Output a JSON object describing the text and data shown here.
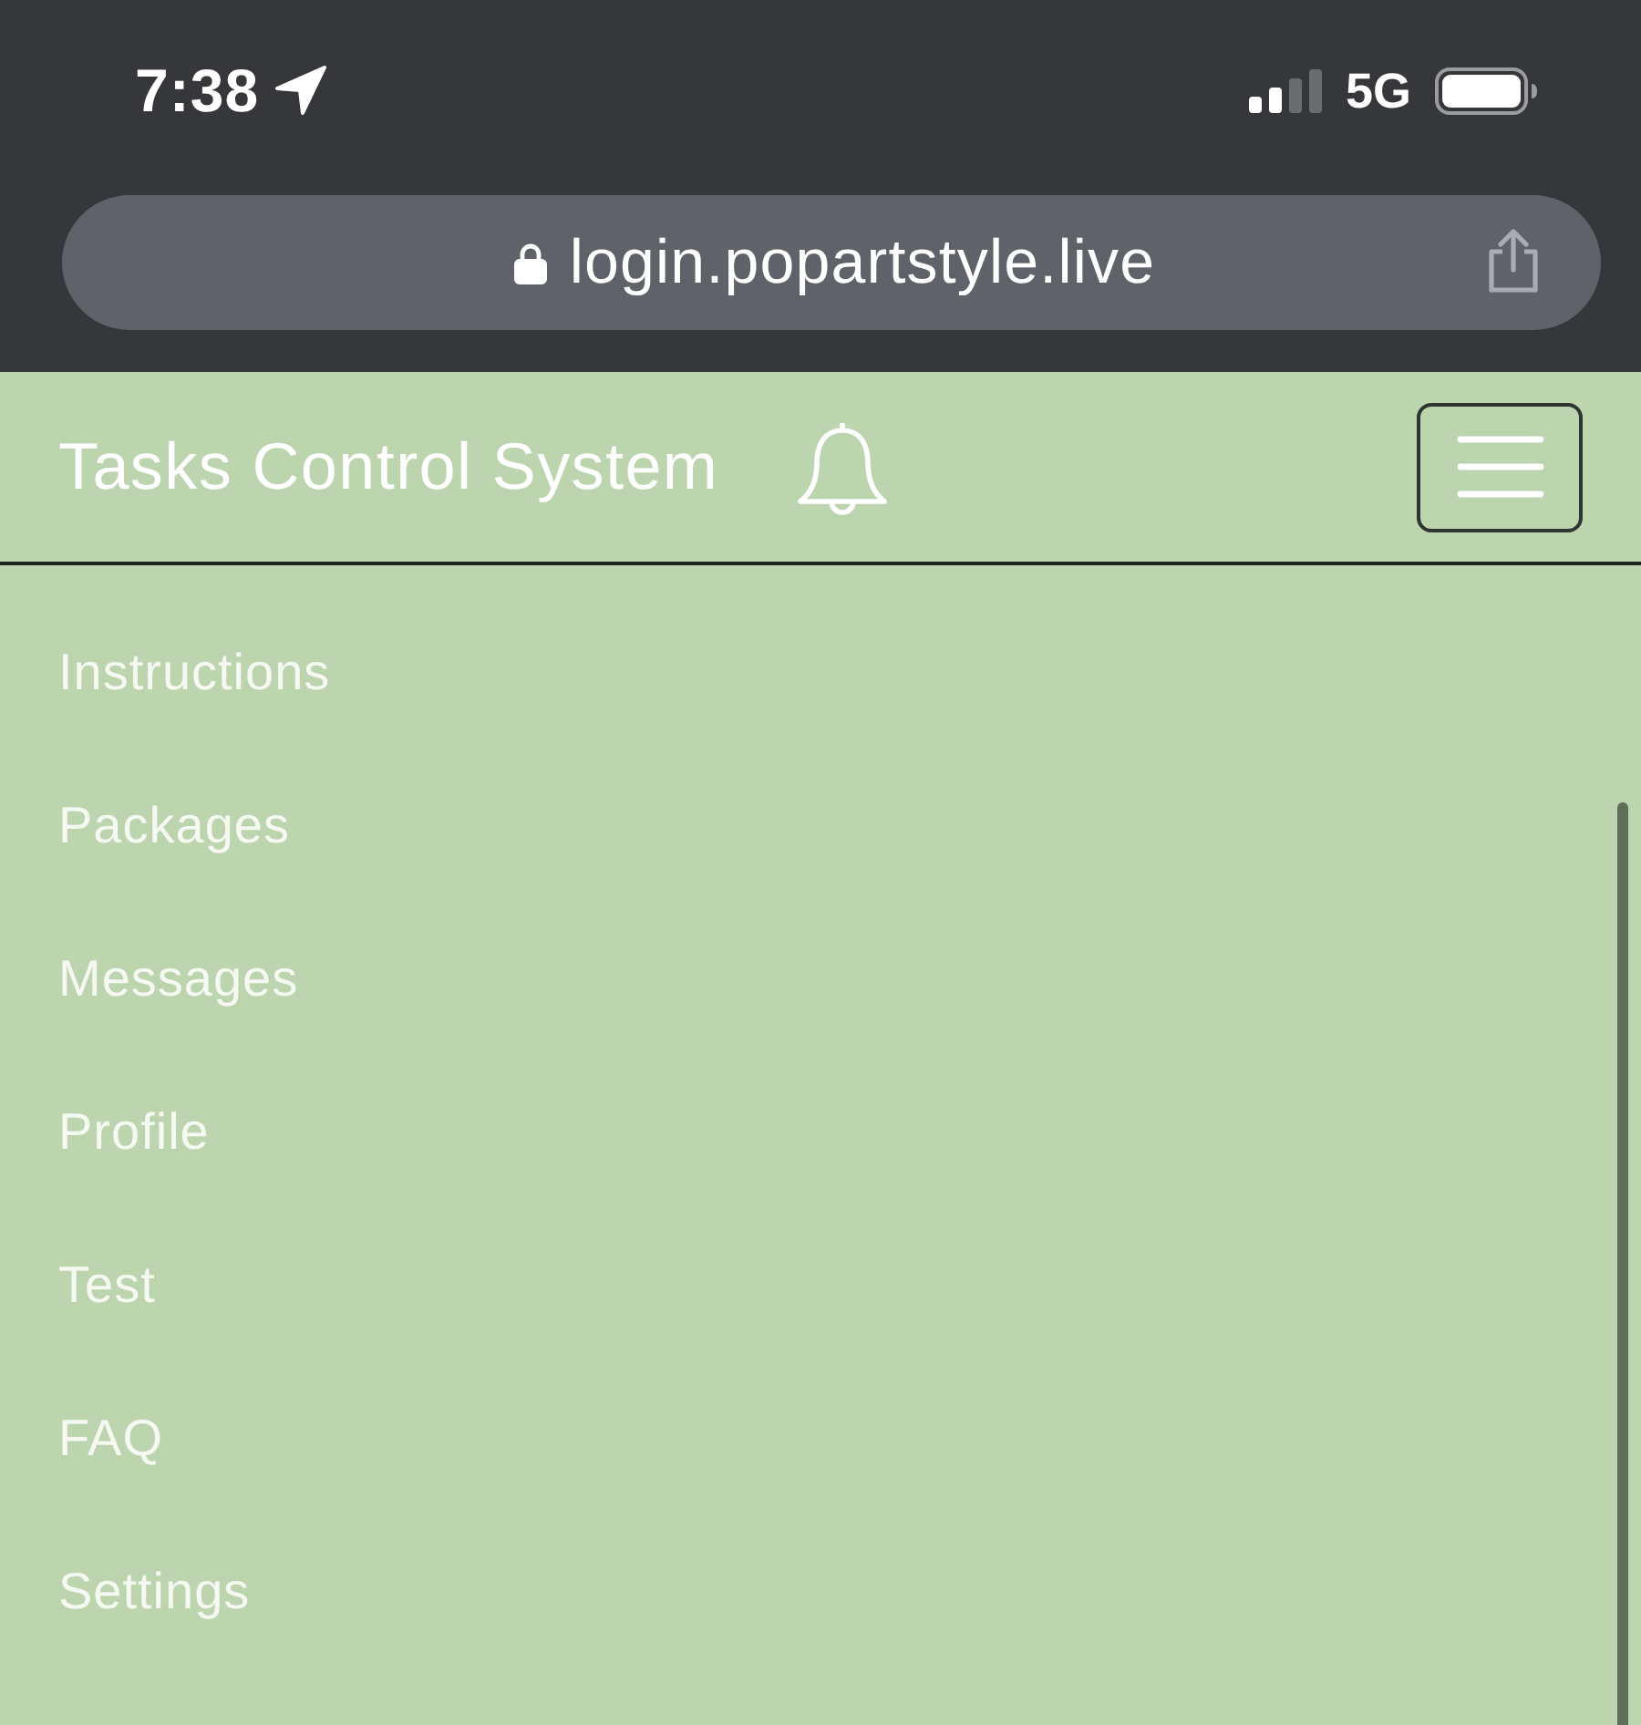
{
  "status_bar": {
    "time": "7:38",
    "network": "5G"
  },
  "address_bar": {
    "url": "login.popartstyle.live"
  },
  "header": {
    "title": "Tasks Control System"
  },
  "menu": {
    "items": [
      {
        "label": "Instructions"
      },
      {
        "label": "Packages"
      },
      {
        "label": "Messages"
      },
      {
        "label": "Profile"
      },
      {
        "label": "Test"
      },
      {
        "label": "FAQ"
      },
      {
        "label": "Settings"
      }
    ]
  }
}
